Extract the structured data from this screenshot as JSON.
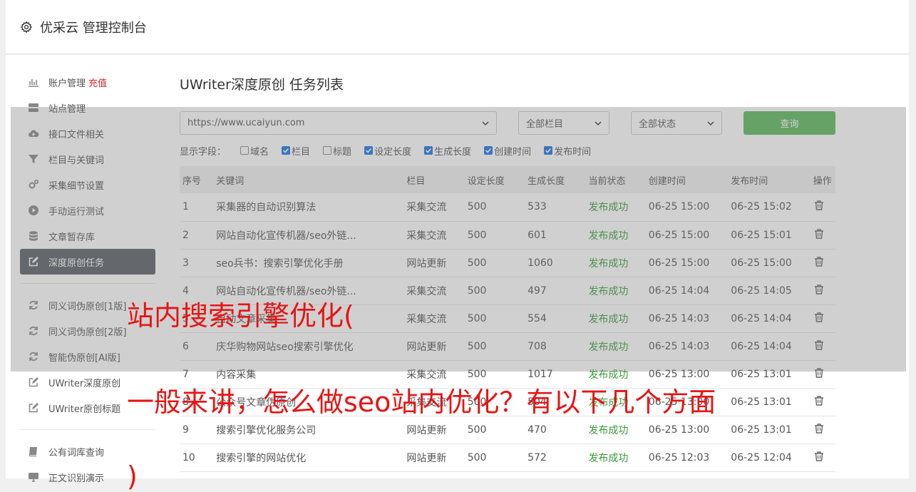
{
  "header": {
    "title": "优采云 管理控制台"
  },
  "sidebar": {
    "group1": [
      {
        "label": "账户管理",
        "extra": "充值",
        "icon": "bar-chart-icon"
      },
      {
        "label": "站点管理",
        "icon": "server-icon"
      },
      {
        "label": "接口文件相关",
        "icon": "cloud-upload-icon"
      },
      {
        "label": "栏目与关键词",
        "icon": "filter-icon"
      },
      {
        "label": "采集细节设置",
        "icon": "cogs-icon"
      },
      {
        "label": "手动运行测试",
        "icon": "play-circle-icon"
      },
      {
        "label": "文章暂存库",
        "icon": "database-icon"
      },
      {
        "label": "深度原创任务",
        "icon": "edit-icon"
      }
    ],
    "group2": [
      {
        "label": "同义词伪原创[1版]",
        "icon": "refresh-icon"
      },
      {
        "label": "同义词伪原创[2版]",
        "icon": "refresh-icon"
      },
      {
        "label": "智能伪原创[AI版]",
        "icon": "refresh-icon"
      },
      {
        "label": "UWriter深度原创",
        "icon": "edit-icon"
      },
      {
        "label": "UWriter原创标题",
        "icon": "edit-icon"
      }
    ],
    "group3": [
      {
        "label": "公有词库查询",
        "icon": "book-icon"
      },
      {
        "label": "正文识别演示",
        "icon": "monitor-icon"
      }
    ]
  },
  "main": {
    "title": "UWriter深度原创 任务列表",
    "site_select": "https://www.ucaiyun.com",
    "column_select": "全部栏目",
    "status_select": "全部状态",
    "query_label": "查询",
    "fields_label": "显示字段：",
    "fields": [
      {
        "label": "域名",
        "checked": false
      },
      {
        "label": "栏目",
        "checked": true
      },
      {
        "label": "标题",
        "checked": false
      },
      {
        "label": "设定长度",
        "checked": true
      },
      {
        "label": "生成长度",
        "checked": true
      },
      {
        "label": "创建时间",
        "checked": true
      },
      {
        "label": "发布时间",
        "checked": true
      }
    ],
    "columns": [
      "序号",
      "关键词",
      "栏目",
      "设定长度",
      "生成长度",
      "当前状态",
      "创建时间",
      "发布时间",
      "操作"
    ],
    "rows": [
      [
        "1",
        "采集器的自动识别算法",
        "采集交流",
        "500",
        "533",
        "发布成功",
        "06-25 15:00",
        "06-25 15:02"
      ],
      [
        "2",
        "网站自动化宣传机器/seo外链...",
        "采集交流",
        "500",
        "601",
        "发布成功",
        "06-25 15:00",
        "06-25 15:01"
      ],
      [
        "3",
        "seo兵书：搜索引擎优化手册",
        "网站更新",
        "500",
        "1060",
        "发布成功",
        "06-25 15:00",
        "06-25 15:00"
      ],
      [
        "4",
        "网站自动化宣传机器/seo外链...",
        "采集交流",
        "500",
        "497",
        "发布成功",
        "06-25 14:04",
        "06-25 14:05"
      ],
      [
        "5",
        "自动文章采集",
        "采集交流",
        "500",
        "554",
        "发布成功",
        "06-25 14:03",
        "06-25 14:04"
      ],
      [
        "6",
        "庆华购物网站seo搜索引擎优化",
        "网站更新",
        "500",
        "708",
        "发布成功",
        "06-25 14:03",
        "06-25 14:04"
      ],
      [
        "7",
        "内容采集",
        "采集交流",
        "500",
        "1017",
        "发布成功",
        "06-25 13:00",
        "06-25 13:01"
      ],
      [
        "8",
        "公众号文章伪原创",
        "采集交流",
        "500",
        "504",
        "发布成功",
        "06-25 13:00",
        "06-25 13:01"
      ],
      [
        "9",
        "搜索引擎优化服务公司",
        "网站更新",
        "500",
        "470",
        "发布成功",
        "06-25 13:00",
        "06-25 13:01"
      ],
      [
        "10",
        "搜索引擎的网站优化",
        "网站更新",
        "500",
        "572",
        "发布成功",
        "06-25 12:03",
        "06-25 12:04"
      ]
    ]
  },
  "overlay_text": {
    "line1": "站内搜索引擎优化(",
    "line2": "一般来讲，怎么做seo站内优化？有以下几个方面",
    "line3": ")"
  },
  "colors": {
    "accent_green": "#5cb85c",
    "status_green": "#3a9a3a",
    "overlay_red": "#e81414",
    "active_nav": "#5a5e66"
  }
}
